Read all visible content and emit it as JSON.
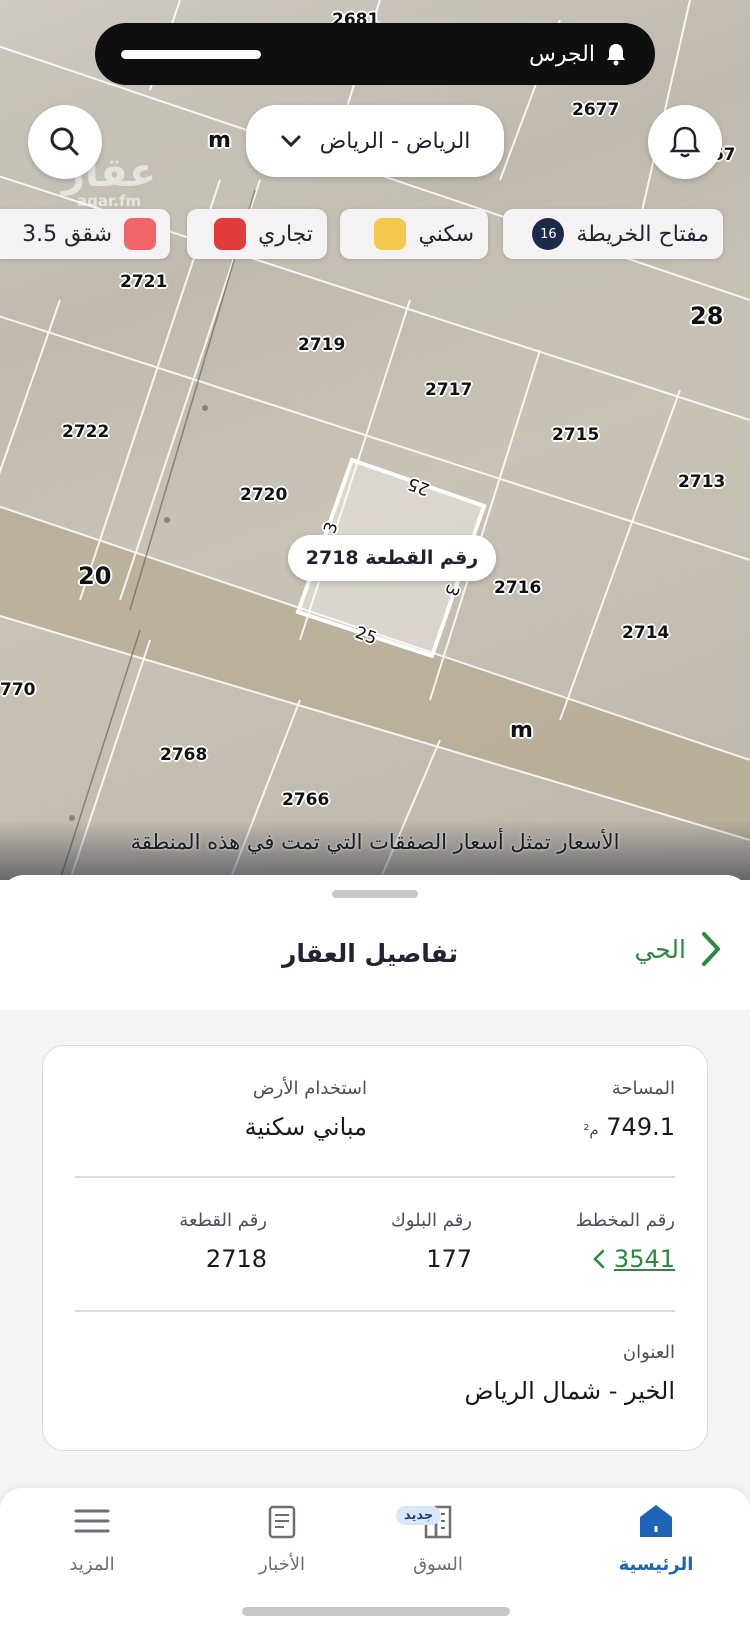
{
  "status": {
    "notification_label": "الجرس"
  },
  "map": {
    "city_select": "الرياض - الرياض",
    "watermark": "عقار",
    "watermark_sub": "aqar.fm",
    "legend_chips": [
      {
        "label": "مفتاح الخريطة",
        "count": "16"
      },
      {
        "label": "سكني",
        "color": "#f2c94c"
      },
      {
        "label": "تجاري",
        "color": "#e23b3b"
      },
      {
        "label": "شقق 3.5",
        "color": "#f0646a"
      }
    ],
    "plot_numbers": [
      "2681",
      "2677",
      "267",
      "2721",
      "2719",
      "2717",
      "2722",
      "2715",
      "2713",
      "2720",
      "2716",
      "2714",
      "770",
      "2768",
      "2766"
    ],
    "street_labels": [
      "28",
      "20",
      "m",
      "m"
    ],
    "selected_parcel_label": "رقم القطعة 2718",
    "dimension_labels": [
      "25",
      "25",
      "3",
      "3"
    ],
    "caption": "الأسعار تمثل أسعار الصفقات التي تمت في هذه المنطقة"
  },
  "sheet": {
    "back_label": "الحي",
    "title": "تفاصيل العقار",
    "fields": {
      "area": {
        "label": "المساحة",
        "value": "749.1",
        "unit": "م²"
      },
      "land_use": {
        "label": "استخدام الأرض",
        "value": "مباني سكنية"
      },
      "plan_no": {
        "label": "رقم المخطط",
        "value": "3541"
      },
      "block_no": {
        "label": "رقم البلوك",
        "value": "177"
      },
      "plot_no": {
        "label": "رقم القطعة",
        "value": "2718"
      },
      "address": {
        "label": "العنوان",
        "value": "الخير - شمال الرياض"
      }
    }
  },
  "tabbar": {
    "tabs": [
      {
        "label": "الرئيسية",
        "icon": "home-icon",
        "active": true
      },
      {
        "label": "السوق",
        "icon": "buildings-icon",
        "badge": "جديد"
      },
      {
        "label": "الأخبار",
        "icon": "news-icon"
      },
      {
        "label": "المزيد",
        "icon": "menu-icon"
      }
    ]
  },
  "colors": {
    "accent_green": "#2a8a3e",
    "active_blue": "#1f63b8",
    "badge_navy": "#1c2a4a"
  }
}
